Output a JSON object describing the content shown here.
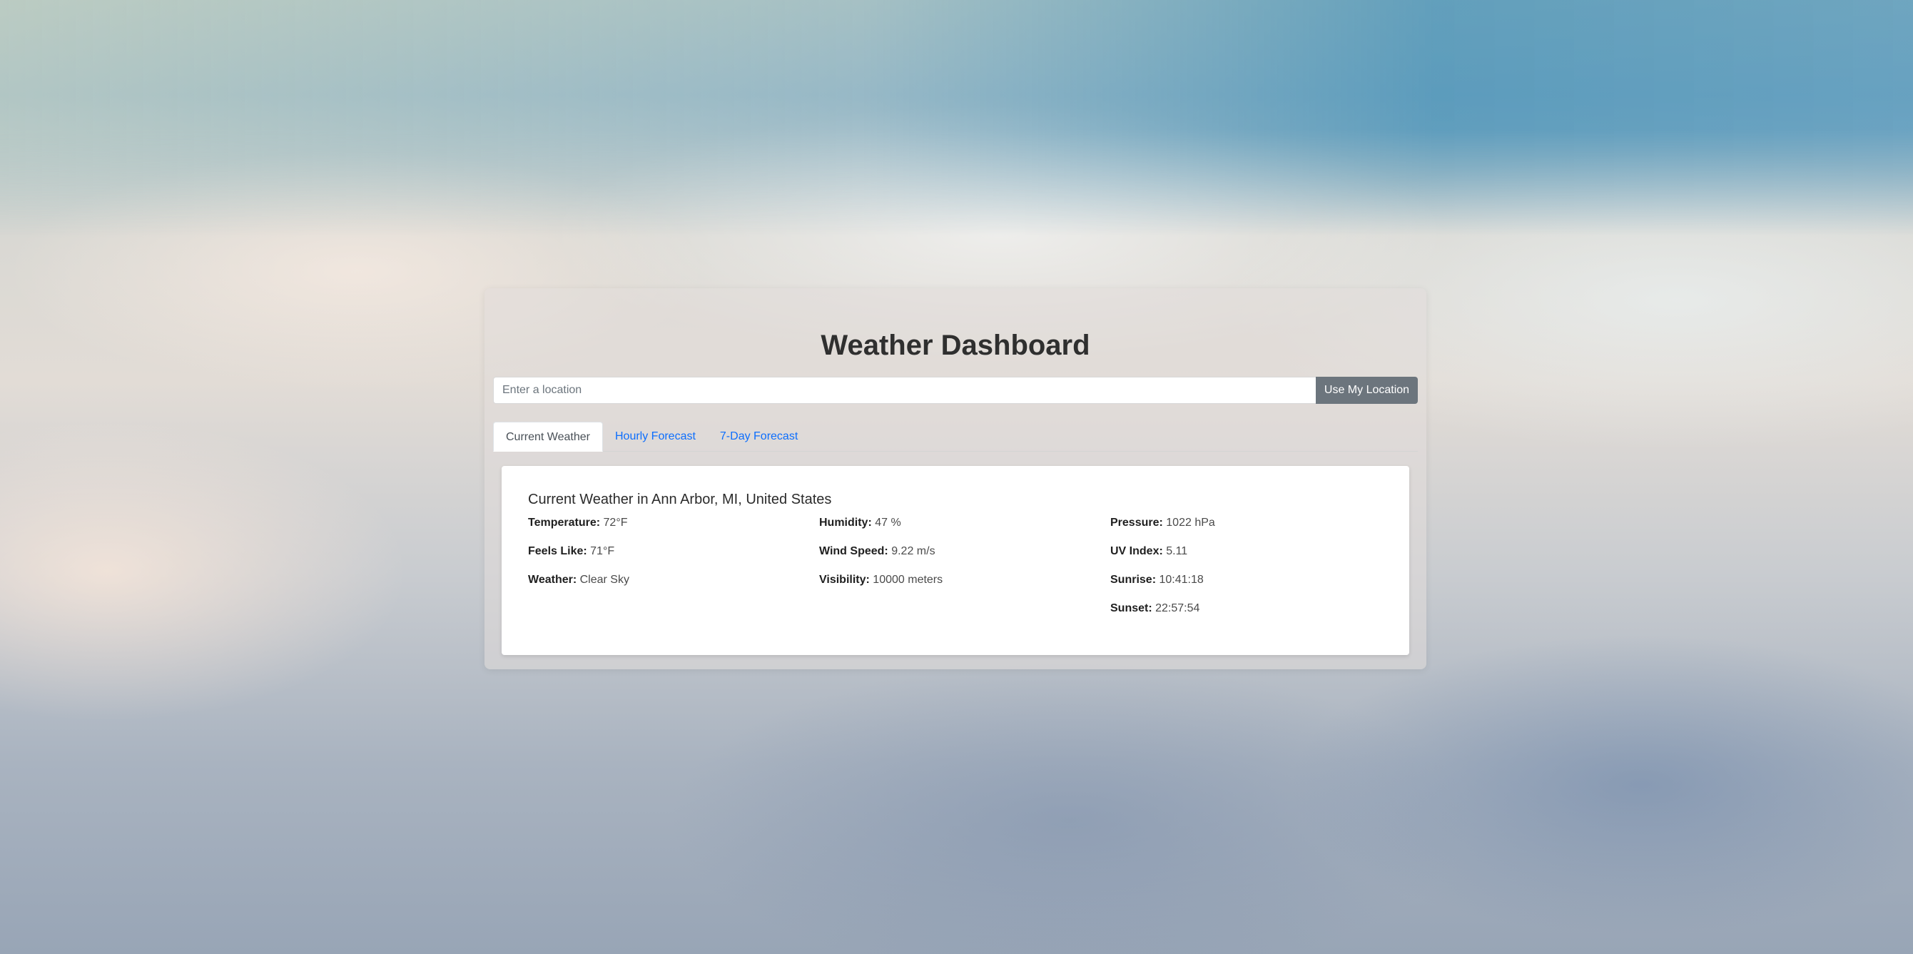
{
  "app": {
    "title": "Weather Dashboard"
  },
  "search": {
    "placeholder": "Enter a location",
    "value": "",
    "location_button": "Use My Location"
  },
  "tabs": [
    {
      "label": "Current Weather",
      "active": true
    },
    {
      "label": "Hourly Forecast",
      "active": false
    },
    {
      "label": "7-Day Forecast",
      "active": false
    }
  ],
  "current": {
    "heading": "Current Weather in Ann Arbor, MI, United States",
    "columns": [
      [
        {
          "label": "Temperature:",
          "value": "72°F"
        },
        {
          "label": "Feels Like:",
          "value": "71°F"
        },
        {
          "label": "Weather:",
          "value": "Clear Sky"
        }
      ],
      [
        {
          "label": "Humidity:",
          "value": "47 %"
        },
        {
          "label": "Wind Speed:",
          "value": "9.22 m/s"
        },
        {
          "label": "Visibility:",
          "value": "10000 meters"
        }
      ],
      [
        {
          "label": "Pressure:",
          "value": "1022 hPa"
        },
        {
          "label": "UV Index:",
          "value": "5.11"
        },
        {
          "label": "Sunrise:",
          "value": "10:41:18"
        },
        {
          "label": "Sunset:",
          "value": "22:57:54"
        }
      ]
    ]
  },
  "colors": {
    "link": "#0d6efd",
    "button": "#6c757d"
  }
}
